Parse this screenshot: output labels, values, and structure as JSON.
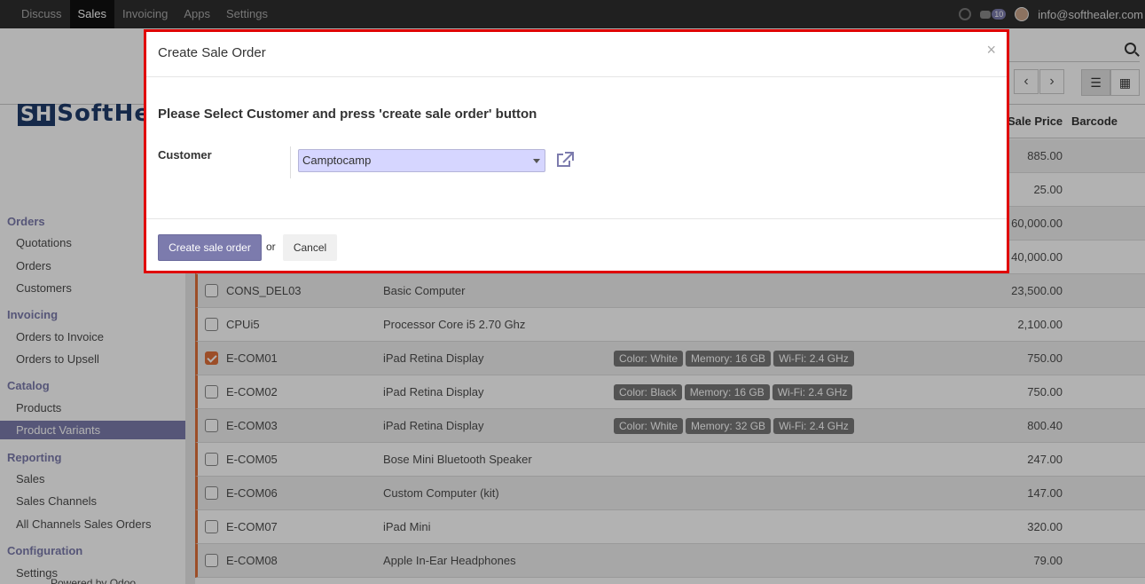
{
  "topbar": {
    "menu": [
      "Discuss",
      "Sales",
      "Invoicing",
      "Apps",
      "Settings"
    ],
    "active_menu": "Sales",
    "chat_count": "10",
    "user_email": "info@softhealer.com"
  },
  "logo": {
    "mark": "SH",
    "text": "SoftHea"
  },
  "sidebar": {
    "sections": [
      {
        "title": "Orders",
        "items": [
          "Quotations",
          "Orders",
          "Customers"
        ]
      },
      {
        "title": "Invoicing",
        "items": [
          "Orders to Invoice",
          "Orders to Upsell"
        ]
      },
      {
        "title": "Catalog",
        "items": [
          "Products",
          "Product Variants"
        ]
      },
      {
        "title": "Reporting",
        "items": [
          "Sales",
          "Sales Channels",
          "All Channels Sales Orders"
        ]
      },
      {
        "title": "Configuration",
        "items": [
          "Settings"
        ]
      }
    ],
    "active_item": "Product Variants",
    "powered_by": "Powered by Odoo"
  },
  "table": {
    "headers": {
      "sale_price": "Sale Price",
      "barcode": "Barcode"
    },
    "rows": [
      {
        "ref": "",
        "name": "",
        "tags": [],
        "price": "885.00",
        "checked": false
      },
      {
        "ref": "",
        "name": "",
        "tags": [],
        "price": "25.00",
        "checked": false
      },
      {
        "ref": "",
        "name": "",
        "tags": [],
        "price": "60,000.00",
        "checked": false
      },
      {
        "ref": "",
        "name": "",
        "tags": [],
        "price": "40,000.00",
        "checked": false
      },
      {
        "ref": "CONS_DEL03",
        "name": "Basic Computer",
        "tags": [],
        "price": "23,500.00",
        "checked": false
      },
      {
        "ref": "CPUi5",
        "name": "Processor Core i5 2.70 Ghz",
        "tags": [],
        "price": "2,100.00",
        "checked": false
      },
      {
        "ref": "E-COM01",
        "name": "iPad Retina Display",
        "tags": [
          "Color: White",
          "Memory: 16 GB",
          "Wi-Fi: 2.4 GHz"
        ],
        "price": "750.00",
        "checked": true
      },
      {
        "ref": "E-COM02",
        "name": "iPad Retina Display",
        "tags": [
          "Color: Black",
          "Memory: 16 GB",
          "Wi-Fi: 2.4 GHz"
        ],
        "price": "750.00",
        "checked": false
      },
      {
        "ref": "E-COM03",
        "name": "iPad Retina Display",
        "tags": [
          "Color: White",
          "Memory: 32 GB",
          "Wi-Fi: 2.4 GHz"
        ],
        "price": "800.40",
        "checked": false
      },
      {
        "ref": "E-COM05",
        "name": "Bose Mini Bluetooth Speaker",
        "tags": [],
        "price": "247.00",
        "checked": false
      },
      {
        "ref": "E-COM06",
        "name": "Custom Computer (kit)",
        "tags": [],
        "price": "147.00",
        "checked": false
      },
      {
        "ref": "E-COM07",
        "name": "iPad Mini",
        "tags": [],
        "price": "320.00",
        "checked": false
      },
      {
        "ref": "E-COM08",
        "name": "Apple In-Ear Headphones",
        "tags": [],
        "price": "79.00",
        "checked": false
      }
    ]
  },
  "modal": {
    "title": "Create Sale Order",
    "close": "×",
    "heading": "Please Select Customer and press 'create sale order' button",
    "customer_label": "Customer",
    "customer_value": "Camptocamp",
    "primary_button": "Create sale order",
    "or_text": "or",
    "cancel_button": "Cancel"
  },
  "colors": {
    "accent": "#7c7bad",
    "highlight": "#e00000",
    "row_marker": "#e0703a"
  }
}
